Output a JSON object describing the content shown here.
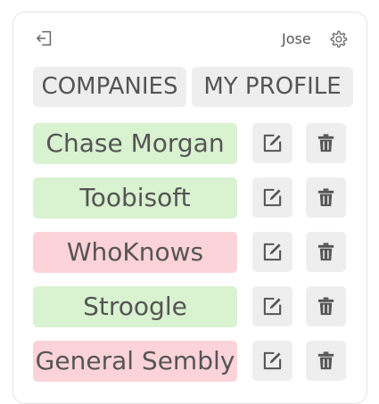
{
  "header": {
    "logout_icon": "logout-icon",
    "user_name": "Jose",
    "settings_icon": "gear-icon"
  },
  "tabs": [
    {
      "label": "COMPANIES"
    },
    {
      "label": "MY PROFILE"
    }
  ],
  "companies": [
    {
      "name": "Chase Morgan",
      "status": "active"
    },
    {
      "name": "Toobisoft",
      "status": "active"
    },
    {
      "name": "WhoKnows",
      "status": "inactive"
    },
    {
      "name": "Stroogle",
      "status": "active"
    },
    {
      "name": "General Sembly",
      "status": "inactive"
    }
  ],
  "colors": {
    "active_bg": "#d9f2d0",
    "inactive_bg": "#fcd3d9",
    "button_bg": "#eeeeee",
    "text": "#555555"
  }
}
